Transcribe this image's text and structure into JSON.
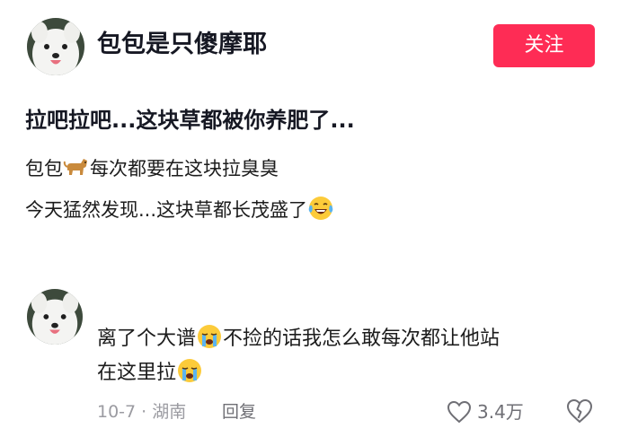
{
  "post": {
    "author_name": "包包是只傻摩耶",
    "follow_label": "关注",
    "title": "拉吧拉吧...这块草都被你养肥了...",
    "body_line1_a": "包包",
    "body_line1_icon": "dog-emoji-icon",
    "body_line1_b": "每次都要在这块拉臭臭",
    "body_line2_a": "今天猛然发现...这块草都长茂盛了",
    "body_line2_icon": "laughing-tears-emoji-icon"
  },
  "comment": {
    "line1_a": "离了个大谱",
    "line1_icon": "crying-emoji-icon",
    "line1_b": "不捡的话我怎么敢每次都让他站",
    "line2_a": "在这里拉",
    "line2_icon": "crying-emoji-icon",
    "date_location": "10-7 · 湖南",
    "reply_label": "回复",
    "like_count": "3.4万"
  },
  "colors": {
    "accent": "#fe2c55",
    "text_primary": "#161823",
    "text_secondary": "#9b9ba1"
  }
}
